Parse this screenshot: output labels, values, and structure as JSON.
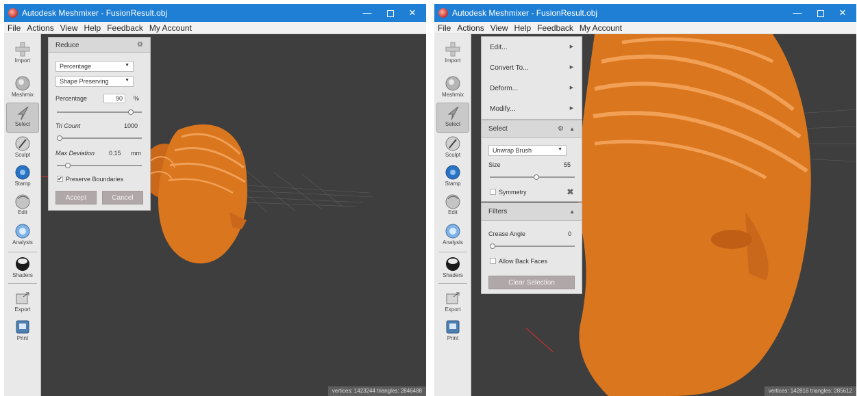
{
  "window_left": {
    "title": "Autodesk Meshmixer - FusionResult.obj",
    "menu": [
      "File",
      "Actions",
      "View",
      "Help",
      "Feedback",
      "My Account"
    ],
    "tools": [
      {
        "label": "Import",
        "icon": "plus-icon"
      },
      {
        "label": "Meshmix",
        "icon": "meshmix-icon"
      },
      {
        "label": "Select",
        "icon": "select-arrow-icon"
      },
      {
        "label": "Sculpt",
        "icon": "sculpt-brush-icon"
      },
      {
        "label": "Stamp",
        "icon": "stamp-icon"
      },
      {
        "label": "Edit",
        "icon": "edit-icon"
      },
      {
        "label": "Analysis",
        "icon": "analysis-icon"
      },
      {
        "label": "Shaders",
        "icon": "shaders-icon"
      },
      {
        "label": "Export",
        "icon": "export-icon"
      },
      {
        "label": "Print",
        "icon": "print-icon"
      }
    ],
    "reduce_panel": {
      "title": "Reduce",
      "mode_dropdown": "Percentage",
      "method_dropdown": "Shape Preserving",
      "percentage_label": "Percentage",
      "percentage_value": "90",
      "percentage_unit": "%",
      "percentage_slider": 0.9,
      "tri_count_label": "Tri Count",
      "tri_count_value": "1000",
      "tri_count_slider": 0.0,
      "max_deviation_label": "Max Deviation",
      "max_deviation_value": "0.15",
      "max_deviation_unit": "mm",
      "max_deviation_slider": 0.1,
      "preserve_boundaries_label": "Preserve Boundaries",
      "preserve_boundaries_checked": true,
      "accept_label": "Accept",
      "cancel_label": "Cancel"
    },
    "status": "vertices: 1423244 triangles: 2846488"
  },
  "window_right": {
    "title": "Autodesk Meshmixer - FusionResult.obj",
    "menu": [
      "File",
      "Actions",
      "View",
      "Help",
      "Feedback",
      "My Account"
    ],
    "context_menu": [
      "Edit...",
      "Convert To...",
      "Deform...",
      "Modify..."
    ],
    "select_panel": {
      "title": "Select",
      "brush_dropdown": "Unwrap Brush",
      "size_label": "Size",
      "size_value": "55",
      "size_slider": 0.55,
      "symmetry_label": "Symmetry",
      "symmetry_checked": false
    },
    "filters_panel": {
      "title": "Filters",
      "crease_angle_label": "Crease Angle",
      "crease_angle_value": "0",
      "crease_angle_slider": 0.0,
      "allow_back_faces_label": "Allow Back Faces",
      "allow_back_faces_checked": false,
      "clear_selection_label": "Clear Selection"
    },
    "status": "vertices: 142816 triangles: 285612"
  },
  "colors": {
    "titlebar": "#1f7fd4",
    "viewport": "#3e3e3e",
    "mesh": "#d9761e",
    "panel": "#e7e7e7",
    "button": "#b0a8a8"
  }
}
